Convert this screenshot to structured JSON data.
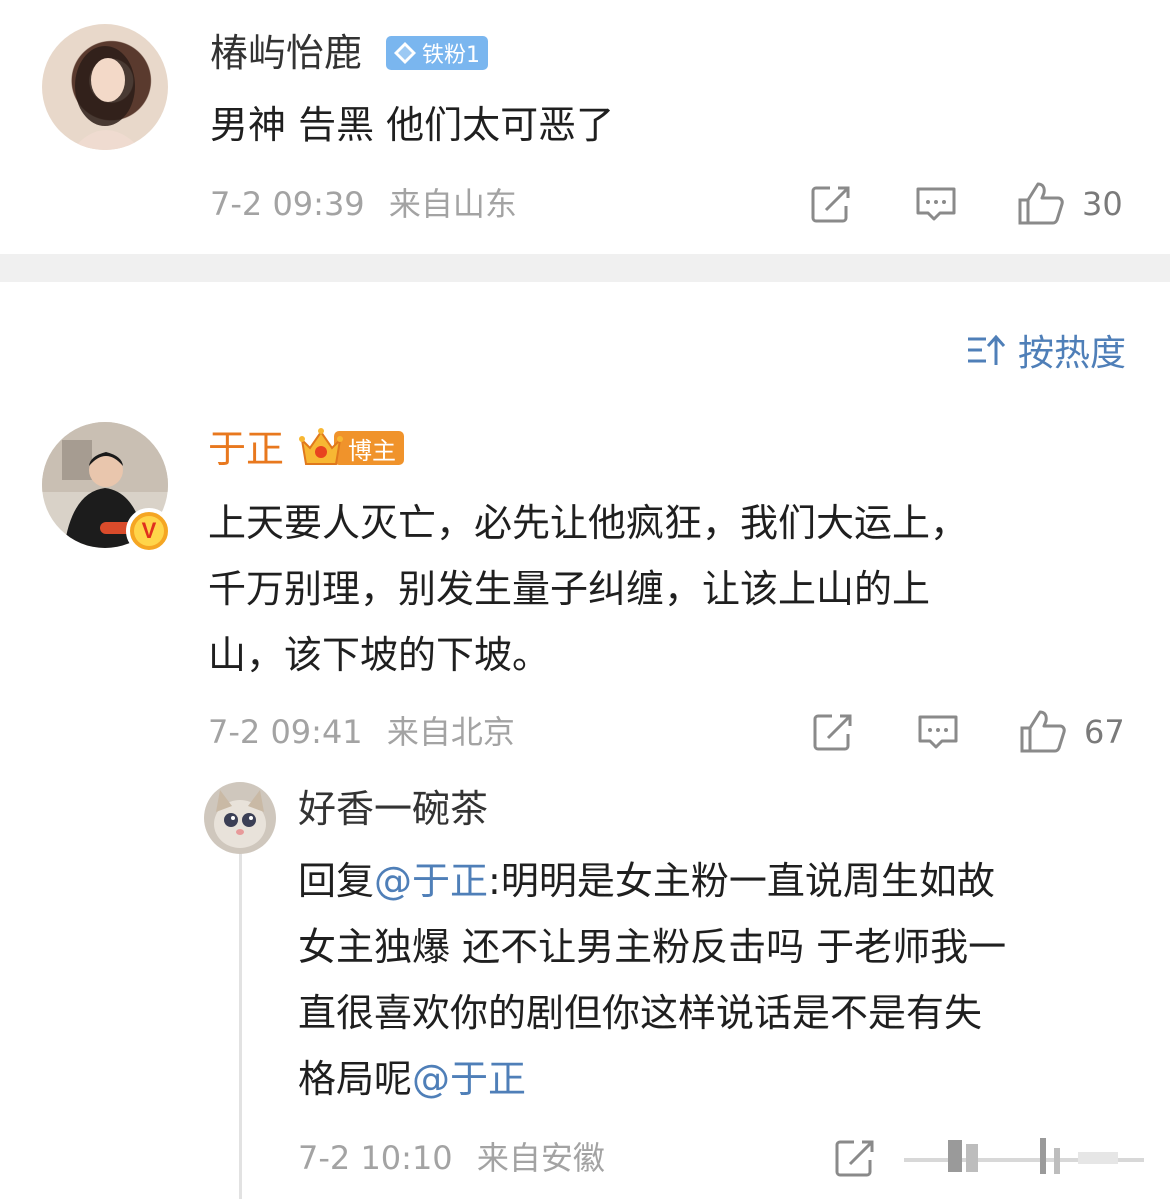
{
  "comment1": {
    "user_name": "椿屿怡鹿",
    "fan_badge": "铁粉1",
    "text": "男神 告黑 他们太可恶了",
    "time": "7-2 09:39",
    "location": "来自山东",
    "like_count": "30"
  },
  "sort": {
    "label": "按热度"
  },
  "comment2": {
    "user_name": "于正",
    "role_badge": "博主",
    "verified_mark": "V",
    "text_line1": "上天要人灭亡，必先让他疯狂，我们大运上，",
    "text_line2": "千万别理，别发生量子纠缠，让该上山的上",
    "text_line3": "山，该下坡的下坡。",
    "time": "7-2 09:41",
    "location": "来自北京",
    "like_count": "67"
  },
  "reply": {
    "user_name": "好香一碗茶",
    "prefix": "回复",
    "mention1": "@于正",
    "line1_rest": ":明明是女主粉一直说周生如故",
    "line2": "女主独爆 还不让男主粉反击吗 于老师我一",
    "line3": "直很喜欢你的剧但你这样说话是不是有失",
    "line4_text": "格局呢",
    "mention2": "@于正",
    "time": "7-2 10:10",
    "location": "来自安徽"
  },
  "colors": {
    "accent_orange": "#e8781e",
    "link_blue": "#4f7fb8",
    "meta_gray": "#a3a3a3",
    "divider": "#f0f0f0"
  },
  "icons": [
    "share-icon",
    "comment-icon",
    "like-icon",
    "sort-icon",
    "crown-icon",
    "diamond-icon"
  ]
}
